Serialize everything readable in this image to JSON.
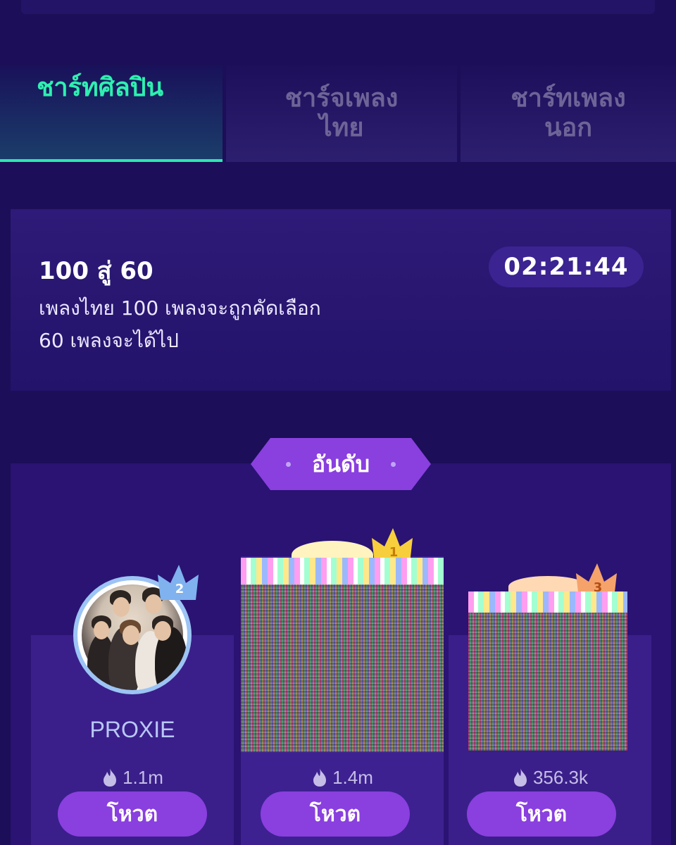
{
  "tabs": [
    {
      "label": "ชาร์ทศิลปิน",
      "active": true
    },
    {
      "label": "ชาร์จเพลง\nไทย",
      "active": false
    },
    {
      "label": "ชาร์ทเพลง\nนอก",
      "active": false
    }
  ],
  "info": {
    "title": "100 สู่ 60",
    "description": "เพลงไทย 100 เพลงจะถูกคัดเลือก 60 เพลงจะได้ไป",
    "timer": "02:21:44"
  },
  "ranking": {
    "header": "อันดับ",
    "entries": [
      {
        "rank": "2",
        "name": "PROXIE",
        "votes": "1.1m",
        "vote_label": "โหวต"
      },
      {
        "rank": "1",
        "name": "",
        "votes": "1.4m",
        "vote_label": "โหวต"
      },
      {
        "rank": "3",
        "name": "",
        "votes": "356.3k",
        "vote_label": "โหวต"
      }
    ]
  },
  "colors": {
    "background": "#1c0e58",
    "active_tab": "#2ef0b0",
    "inactive_tab": "#6e6497",
    "vote_button": "#8a3fdf",
    "crown_gold": "#f7cf3c",
    "crown_silver": "#9cc4f4",
    "crown_bronze": "#f5a36a"
  },
  "icons": {
    "vote_count": "flame-icon",
    "rank_badge": "crown-icon"
  }
}
